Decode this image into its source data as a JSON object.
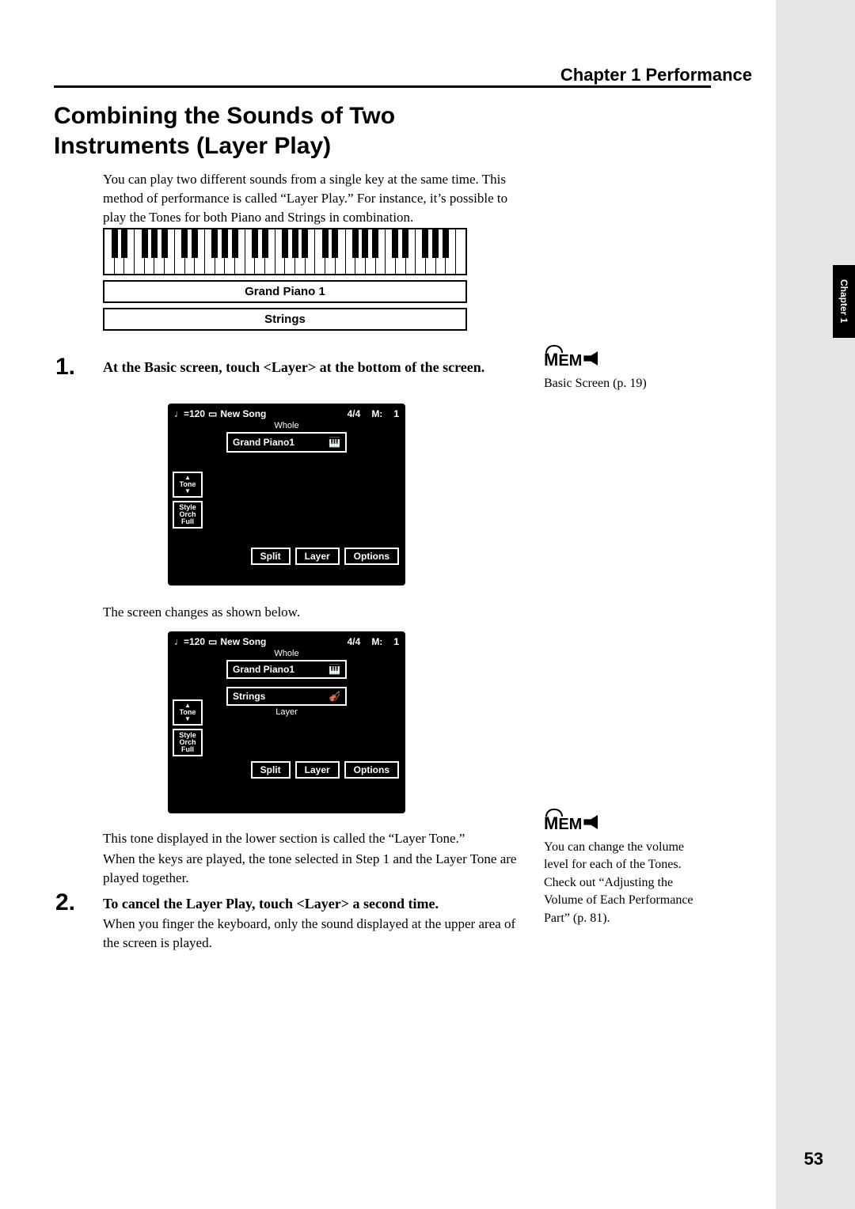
{
  "header": {
    "chapter": "Chapter 1 Performance"
  },
  "title": "Combining the Sounds of Two Instruments (Layer Play)",
  "intro": "You can play two different sounds from a single key at the same time. This method of performance is called “Layer Play.” For instance, it’s possible to play the Tones for both Piano and Strings in combination.",
  "diagram": {
    "layer1": "Grand Piano 1",
    "layer2": "Strings"
  },
  "step1": {
    "num": "1.",
    "text": "At the Basic screen, touch <Layer> at the bottom of the screen."
  },
  "lcd_common": {
    "tempo_prefix": "♩=120",
    "song": "New Song",
    "timesig": "4/4",
    "measure_label": "M:",
    "measure": "1",
    "whole": "Whole",
    "tone1": "Grand Piano1",
    "tone2": "Strings",
    "layer_label": "Layer",
    "side_tone": "Tone",
    "side_style": "Style\nOrch\nFull",
    "btn_split": "Split",
    "btn_layer": "Layer",
    "btn_options": "Options"
  },
  "aftertext": "The screen changes as shown below.",
  "para_layer_tone": "This tone displayed in the lower section is called the “Layer Tone.”",
  "para_played": "When the keys are played, the tone selected in Step 1 and the Layer Tone are played together.",
  "step2": {
    "num": "2.",
    "text": "To cancel the Layer Play, touch <Layer> a second time.",
    "body": "When you finger the keyboard, only the sound displayed at the upper area of the screen is played."
  },
  "memo1": {
    "label": "MEMO",
    "text": "Basic Screen (p. 19)"
  },
  "memo2": {
    "label": "MEMO",
    "text": "You can change the volume level for each of the Tones. Check out “Adjusting the Volume of Each Performance Part” (p. 81)."
  },
  "sidetab": "Chapter 1",
  "pagenum": "53"
}
